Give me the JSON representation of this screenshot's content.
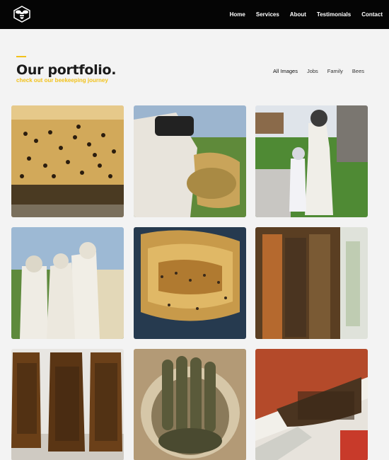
{
  "header": {
    "logo_icon": "bee-icon",
    "nav": [
      "Home",
      "Services",
      "About",
      "Testimonials",
      "Contact"
    ]
  },
  "section": {
    "title": "Our portfolio.",
    "subtitle": "check out our beekeeping journey",
    "accent_color": "#f2c21b"
  },
  "filters": {
    "items": [
      "All Images",
      "Jobs",
      "Family",
      "Bees"
    ],
    "active": "All Images"
  },
  "gallery": {
    "images": [
      "bees-on-hive-box-photo",
      "beekeeper-holding-comb-photo",
      "beekeeper-with-child-photo",
      "two-beekeepers-in-suits-photo",
      "honeycomb-closeup-photo",
      "comb-in-wall-photo",
      "three-comb-slabs-photo",
      "comb-cluster-in-bucket-photo",
      "comb-under-eave-photo"
    ]
  }
}
